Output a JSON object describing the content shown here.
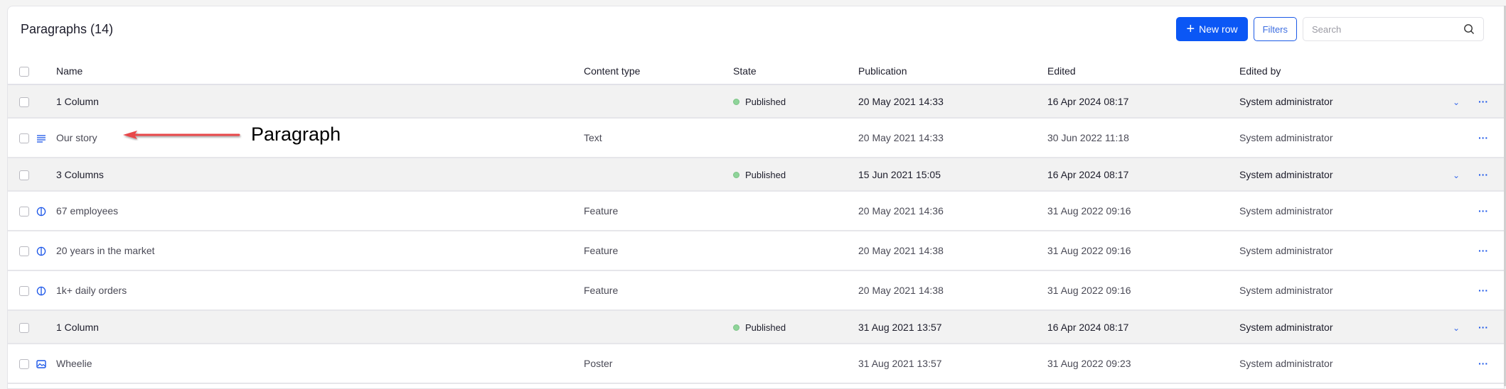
{
  "header": {
    "title": "Paragraphs (14)",
    "new_row_label": "New row",
    "filters_label": "Filters",
    "search_placeholder": "Search"
  },
  "columns": [
    "Name",
    "Content type",
    "State",
    "Publication",
    "Edited",
    "Edited by"
  ],
  "rows": [
    {
      "kind": "group",
      "icon": "",
      "name": "1 Column",
      "type": "",
      "state": "Published",
      "publication": "20 May 2021 14:33",
      "edited": "16 Apr 2024 08:17",
      "edited_by": "System administrator"
    },
    {
      "kind": "child",
      "icon": "text-paragraph-icon",
      "name": "Our story",
      "type": "Text",
      "state": "",
      "publication": "20 May 2021 14:33",
      "edited": "30 Jun 2022 11:18",
      "edited_by": "System administrator"
    },
    {
      "kind": "group",
      "icon": "",
      "name": "3 Columns",
      "type": "",
      "state": "Published",
      "publication": "15 Jun 2021 15:05",
      "edited": "16 Apr 2024 08:17",
      "edited_by": "System administrator"
    },
    {
      "kind": "child",
      "icon": "feature-icon",
      "name": "67 employees",
      "type": "Feature",
      "state": "",
      "publication": "20 May 2021 14:36",
      "edited": "31 Aug 2022 09:16",
      "edited_by": "System administrator"
    },
    {
      "kind": "child",
      "icon": "feature-icon",
      "name": "20 years in the market",
      "type": "Feature",
      "state": "",
      "publication": "20 May 2021 14:38",
      "edited": "31 Aug 2022 09:16",
      "edited_by": "System administrator"
    },
    {
      "kind": "child",
      "icon": "feature-icon",
      "name": "1k+ daily orders",
      "type": "Feature",
      "state": "",
      "publication": "20 May 2021 14:38",
      "edited": "31 Aug 2022 09:16",
      "edited_by": "System administrator"
    },
    {
      "kind": "group",
      "icon": "",
      "name": "1 Column",
      "type": "",
      "state": "Published",
      "publication": "31 Aug 2021 13:57",
      "edited": "16 Apr 2024 08:17",
      "edited_by": "System administrator"
    },
    {
      "kind": "child",
      "icon": "poster-image-icon",
      "name": "Wheelie",
      "type": "Poster",
      "state": "",
      "publication": "31 Aug 2021 13:57",
      "edited": "31 Aug 2022 09:23",
      "edited_by": "System administrator"
    }
  ],
  "annotation": {
    "label": "Paragraph",
    "color": "#e8464a"
  },
  "colors": {
    "accent": "#0b57f5",
    "published": "#8fd49a",
    "group_bg": "#f2f2f2"
  }
}
